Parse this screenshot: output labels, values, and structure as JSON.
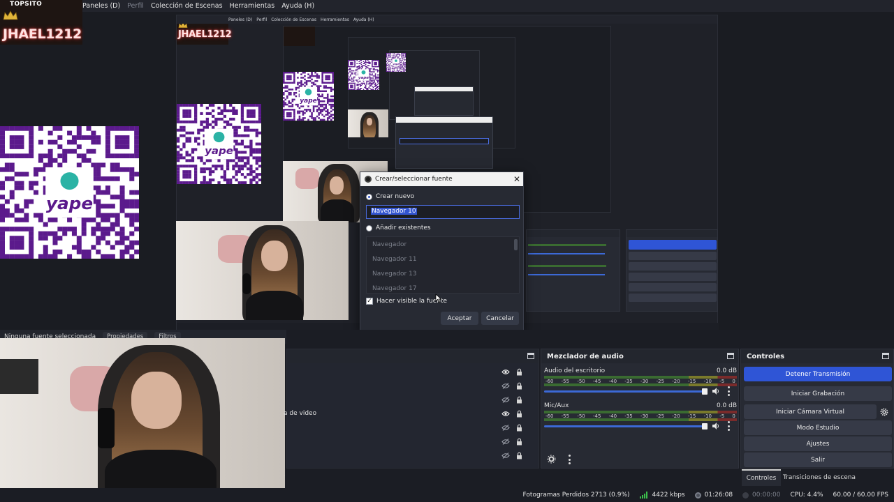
{
  "brand": {
    "top": "TOPSITO",
    "name": "JHAEL1212"
  },
  "menubar": [
    {
      "label": "Paneles (D)",
      "disabled": false
    },
    {
      "label": "Perfil",
      "disabled": true
    },
    {
      "label": "Colección de Escenas",
      "disabled": false
    },
    {
      "label": "Herramientas",
      "disabled": false
    },
    {
      "label": "Ayuda (H)",
      "disabled": false
    }
  ],
  "nested_menubar": [
    "Paneles (D)",
    "Perfil",
    "Colección de Escenas",
    "Herramientas",
    "Ayuda (H)"
  ],
  "qr_logo": "yape",
  "dialog": {
    "title": "Crear/seleccionar fuente",
    "create_new_label": "Crear nuevo",
    "name_value": "Navegador 10",
    "add_existing_label": "Añadir existentes",
    "existing": [
      "Navegador",
      "Navegador 11",
      "Navegador 13",
      "Navegador 17"
    ],
    "make_visible_label": "Hacer visible la fuente",
    "accept_label": "Aceptar",
    "cancel_label": "Cancelar"
  },
  "source_toolbar": {
    "no_source": "Ninguna fuente seleccionada",
    "properties_label": "Propiedades",
    "filters_label": "Filtros"
  },
  "sources": {
    "visible_partial_label": "a de video",
    "rows": [
      {
        "visible": true
      },
      {
        "visible": false
      },
      {
        "visible": false
      },
      {
        "visible": true
      },
      {
        "visible": false
      },
      {
        "visible": false
      },
      {
        "visible": false
      }
    ]
  },
  "mixer": {
    "title": "Mezclador de audio",
    "scale": [
      "-60",
      "-55",
      "-50",
      "-45",
      "-40",
      "-35",
      "-30",
      "-25",
      "-20",
      "-15",
      "-10",
      "-5",
      "0"
    ],
    "channels": [
      {
        "name": "Audio del escritorio",
        "db": "0.0 dB"
      },
      {
        "name": "Mic/Aux",
        "db": "0.0 dB"
      }
    ]
  },
  "controls": {
    "title": "Controles",
    "stop_stream": "Detener Transmisión",
    "start_recording": "Iniciar Grabación",
    "start_virtual_cam": "Iniciar Cámara Virtual",
    "studio_mode": "Modo Estudio",
    "settings": "Ajustes",
    "exit": "Salir"
  },
  "dock_tabs": {
    "controls": "Controles",
    "transitions": "Transiciones de escena"
  },
  "status": {
    "dropped_frames": "Fotogramas Perdidos 2713 (0.9%)",
    "bitrate": "4422 kbps",
    "stream_time": "01:26:08",
    "rec_time": "00:00:00",
    "cpu": "CPU: 4.4%",
    "fps": "60.00 / 60.00 FPS"
  },
  "colors": {
    "accent": "#2f55d6",
    "qr": "#5b1a8c",
    "live": "#3cc04c"
  }
}
